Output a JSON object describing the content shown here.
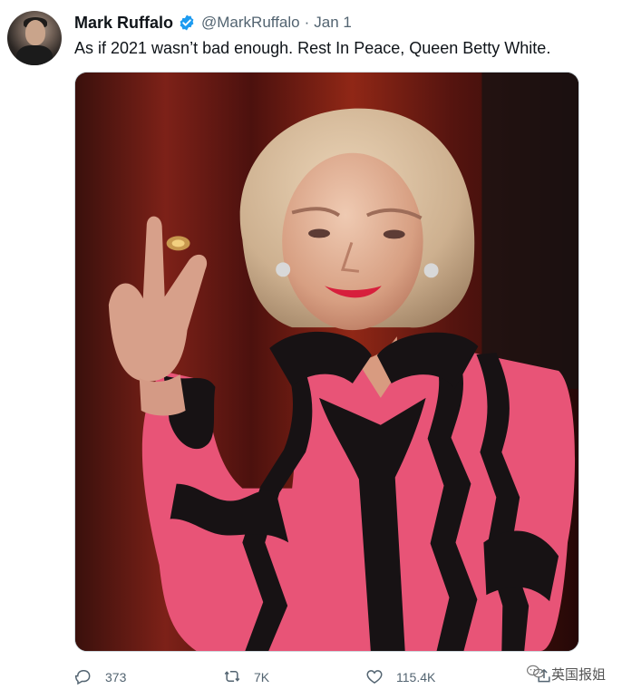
{
  "author": {
    "name": "Mark Ruffalo",
    "handle": "@MarkRuffalo",
    "separator": "·",
    "date": "Jan 1",
    "verified": true
  },
  "tweet": {
    "text": "As if 2021 wasn’t bad enough. Rest In Peace, Queen Betty White."
  },
  "actions": {
    "reply_count": "373",
    "retweet_count": "7K",
    "like_count": "115.4K"
  },
  "watermark": {
    "text": "英国报姐"
  },
  "icons": {
    "avatar": "profile-avatar",
    "verified": "verified-badge-icon",
    "reply": "reply-icon",
    "retweet": "retweet-icon",
    "like": "heart-icon",
    "share": "share-icon",
    "watermark": "wechat-icon"
  },
  "colors": {
    "verified_blue": "#1d9bf0",
    "muted_text": "#536471",
    "image_background": "#1b0908",
    "blouse_pink": "#e85477"
  }
}
